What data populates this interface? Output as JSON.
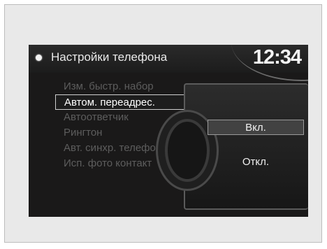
{
  "header": {
    "title": "Настройки телефона",
    "clock": "12:34"
  },
  "menu": {
    "items": [
      {
        "label": "Изм. быстр. набор"
      },
      {
        "label": "Автом. переадрес."
      },
      {
        "label": "Автоответчик"
      },
      {
        "label": "Рингтон"
      },
      {
        "label": "Авт. синхр. телефо"
      },
      {
        "label": "Исп. фото контакт"
      }
    ],
    "selected_index": 1
  },
  "popup": {
    "options": [
      {
        "label": "Вкл."
      },
      {
        "label": "Откл."
      }
    ],
    "highlighted_index": 0
  },
  "colors": {
    "screen_bg": "#1a1919",
    "text_active": "#ffffff",
    "text_dim": "#5d5d5d"
  }
}
